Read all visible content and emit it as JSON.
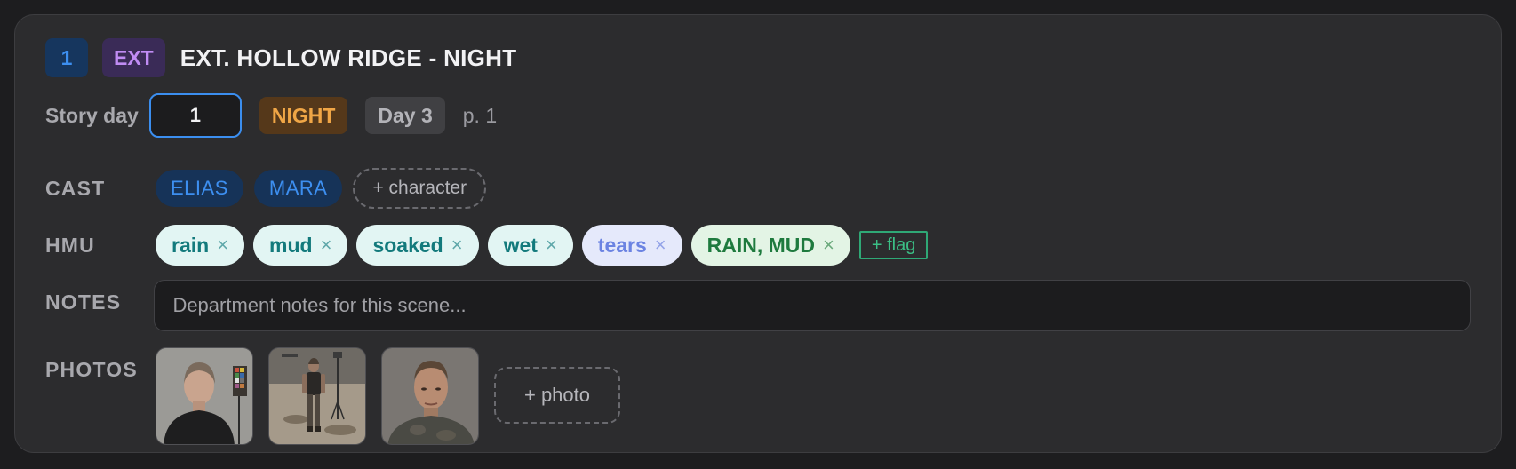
{
  "scene": {
    "number": "1",
    "int_ext": "EXT",
    "heading": "EXT. HOLLOW RIDGE - NIGHT"
  },
  "story_day": {
    "label": "Story day",
    "value": "1",
    "time_of_day": "NIGHT",
    "shoot_day": "Day 3",
    "page": "p. 1"
  },
  "cast": {
    "label": "CAST",
    "members": [
      "ELIAS",
      "MARA"
    ],
    "add_label": "+ character"
  },
  "hmu": {
    "label": "HMU",
    "tags": [
      {
        "text": "rain",
        "style": "teal"
      },
      {
        "text": "mud",
        "style": "teal"
      },
      {
        "text": "soaked",
        "style": "teal"
      },
      {
        "text": "wet",
        "style": "teal"
      },
      {
        "text": "tears",
        "style": "blue"
      },
      {
        "text": "RAIN, MUD",
        "style": "green"
      }
    ],
    "remove_glyph": "×",
    "add_label": "+ flag"
  },
  "notes": {
    "label": "NOTES",
    "value": "",
    "placeholder": "Department notes for this scene..."
  },
  "photos": {
    "label": "PHOTOS",
    "items": [
      {
        "subject": "woman-portrait-color-chart"
      },
      {
        "subject": "woman-full-body-mud-set"
      },
      {
        "subject": "man-portrait-mud"
      }
    ],
    "add_label": "+ photo"
  },
  "colors": {
    "card_bg": "#2c2c2e",
    "page_bg": "#1d1d1f",
    "accent_blue": "#3d8ff0",
    "accent_purple": "#c08cf4",
    "night_orange": "#f0a646",
    "flag_green": "#3bbf86"
  }
}
